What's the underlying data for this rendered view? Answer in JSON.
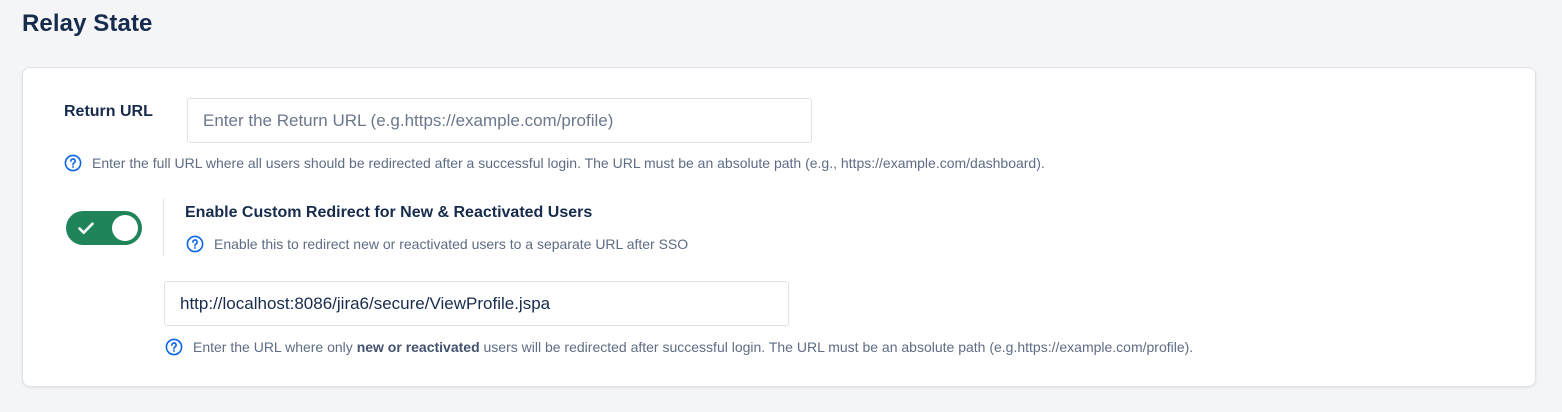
{
  "section": {
    "title": "Relay State"
  },
  "return_url": {
    "label": "Return URL",
    "placeholder": "Enter the Return URL (e.g.https://example.com/profile)",
    "value": "",
    "help": "Enter the full URL where all users should be redirected after a successful login. The URL must be an absolute path (e.g., https://example.com/dashboard)."
  },
  "custom_redirect": {
    "toggle_on": true,
    "title": "Enable Custom Redirect for New & Reactivated Users",
    "help": "Enable this to redirect new or reactivated users to a separate URL after SSO",
    "value": "http://localhost:8086/jira6/secure/ViewProfile.jspa",
    "url_help_prefix": "Enter the URL where only ",
    "url_help_bold": "new or reactivated",
    "url_help_suffix": " users will be redirected after successful login. The URL must be an absolute path (e.g.https://example.com/profile)."
  },
  "colors": {
    "toggle_on": "#1f845a",
    "help_icon": "#0c66e4",
    "text_primary": "#172b4d",
    "text_subtle": "#5e6c84"
  },
  "icons": {
    "help": "question-circle-icon",
    "toggle_check": "check-icon"
  }
}
